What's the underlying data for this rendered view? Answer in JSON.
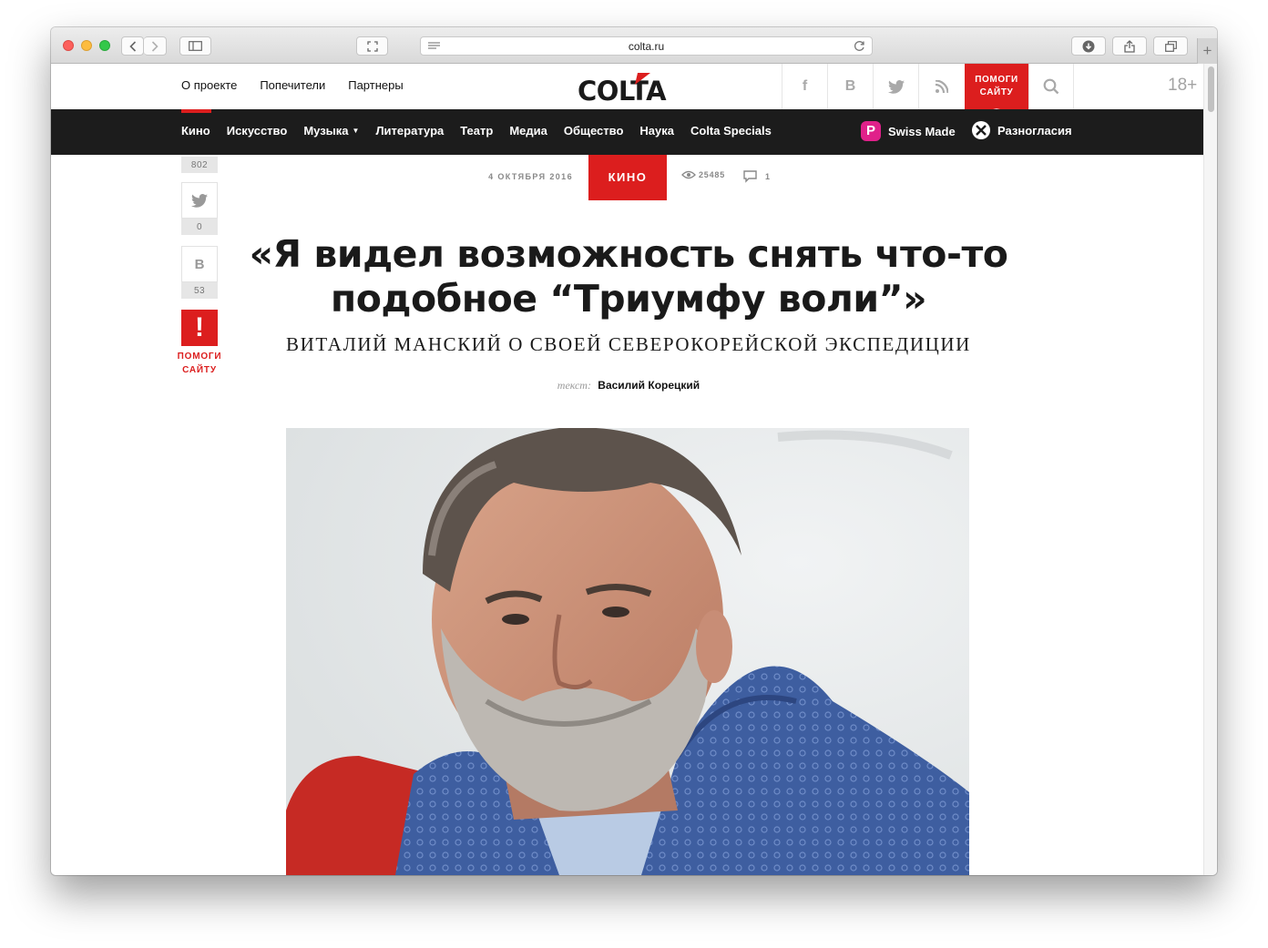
{
  "browser": {
    "url": "colta.ru"
  },
  "site": {
    "logo_text": "COLTA",
    "top_links": [
      {
        "label": "О проекте"
      },
      {
        "label": "Попечители"
      },
      {
        "label": "Партнеры"
      }
    ],
    "social": {
      "facebook": "f",
      "vkontakte": "B"
    },
    "support_label": "ПОМОГИ САЙТУ",
    "age_rating": "18+",
    "nav": [
      {
        "label": "Кино"
      },
      {
        "label": "Искусство"
      },
      {
        "label": "Музыка"
      },
      {
        "label": "Литература"
      },
      {
        "label": "Театр"
      },
      {
        "label": "Медиа"
      },
      {
        "label": "Общество"
      },
      {
        "label": "Наука"
      },
      {
        "label": "Colta Specials"
      }
    ],
    "partners": [
      {
        "label": "Swiss Made",
        "icon_letter": "P"
      },
      {
        "label": "Разногласия"
      }
    ]
  },
  "share": {
    "top_count": "802",
    "twitter_count": "0",
    "vk_label": "B",
    "vk_count": "53",
    "support_mark": "!",
    "support_label_1": "ПОМОГИ",
    "support_label_2": "САЙТУ"
  },
  "article": {
    "date": "4 ОКТЯБРЯ 2016",
    "rubric": "КИНО",
    "views": "25485",
    "comments": "1",
    "title": "«Я видел возможность снять что-то подобное “Триумфу воли”»",
    "subtitle": "Виталий Манский о своей северокорейской экспедиции",
    "byline_label": "текст:",
    "author": "Василий Корецкий"
  },
  "colors": {
    "brand_red": "#dc1e1e",
    "nav_bg": "#1c1c1c",
    "partner_pink": "#e0218a"
  }
}
